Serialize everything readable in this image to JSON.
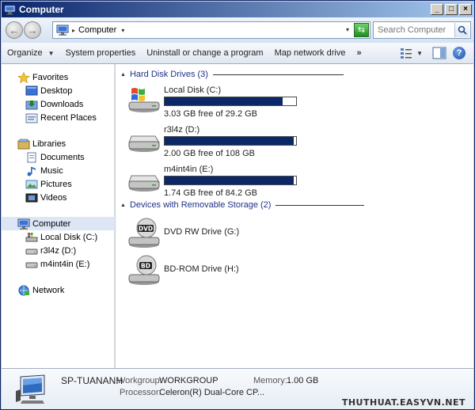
{
  "window": {
    "title": "Computer",
    "min_label": "_",
    "max_label": "□",
    "close_label": "×"
  },
  "address": {
    "path": "Computer",
    "separator": "▸",
    "dropdown": "▾"
  },
  "search": {
    "placeholder": "Search Computer"
  },
  "toolbar": {
    "items": [
      "Organize",
      "System properties",
      "Uninstall or change a program",
      "Map network drive"
    ],
    "more": "»"
  },
  "navpane": {
    "favorites": {
      "label": "Favorites",
      "items": [
        "Desktop",
        "Downloads",
        "Recent Places"
      ]
    },
    "libraries": {
      "label": "Libraries",
      "items": [
        "Documents",
        "Music",
        "Pictures",
        "Videos"
      ]
    },
    "computer": {
      "label": "Computer",
      "items": [
        "Local Disk (C:)",
        "r3l4z (D:)",
        "m4int4in (E:)"
      ]
    },
    "network": {
      "label": "Network"
    }
  },
  "content": {
    "hard_disks": {
      "header": "Hard Disk Drives (3)",
      "drives": [
        {
          "name": "Local Disk (C:)",
          "free": "3.03 GB free of 29.2 GB",
          "used_fraction": 0.896,
          "icon": "windows-drive-icon"
        },
        {
          "name": "r3l4z (D:)",
          "free": "2.00 GB free of 108 GB",
          "used_fraction": 0.981,
          "icon": "hard-drive-icon"
        },
        {
          "name": "m4int4in (E:)",
          "free": "1.74 GB free of 84.2 GB",
          "used_fraction": 0.979,
          "icon": "hard-drive-icon"
        }
      ]
    },
    "removable": {
      "header": "Devices with Removable Storage (2)",
      "drives": [
        {
          "name": "DVD RW Drive (G:)",
          "badge": "DVD",
          "icon": "dvd-drive-icon"
        },
        {
          "name": "BD-ROM Drive (H:)",
          "badge": "BD",
          "icon": "bd-drive-icon"
        }
      ]
    }
  },
  "details": {
    "computer_name": "SP-TUANANH",
    "workgroup_label": "Workgroup:",
    "workgroup": "WORKGROUP",
    "memory_label": "Memory:",
    "memory": "1.00 GB",
    "processor_label": "Processor:",
    "processor": "Celeron(R) Dual-Core CP...",
    "watermark": "THUTHUAT.EASYVN.NET"
  },
  "colors": {
    "usage_bar": "#0d2866",
    "group_header": "#1e3287",
    "selection": "#dce6f4"
  }
}
